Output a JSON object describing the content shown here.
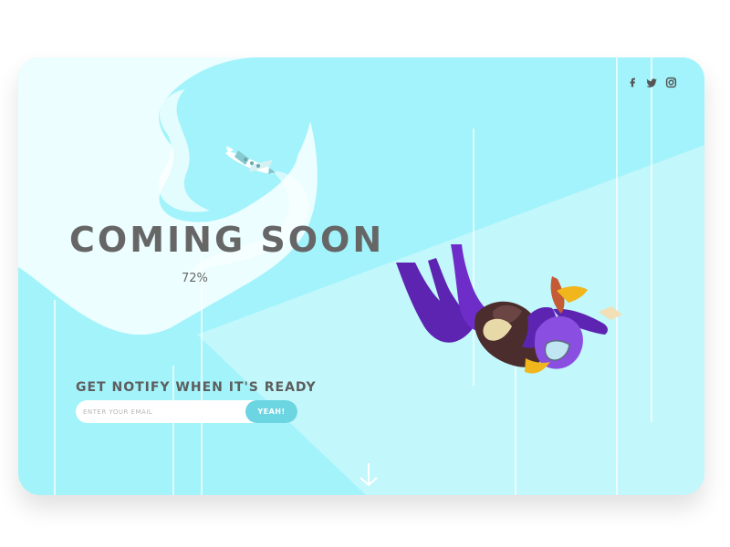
{
  "page": {
    "title": "COMING SOON",
    "progress_label": "72%",
    "progress_value": 0.72
  },
  "social": {
    "items": [
      {
        "name": "facebook",
        "icon": "facebook-icon"
      },
      {
        "name": "twitter",
        "icon": "twitter-icon"
      },
      {
        "name": "instagram",
        "icon": "instagram-icon"
      }
    ]
  },
  "notify": {
    "heading": "GET NOTIFY WHEN IT'S READY",
    "email_placeholder": "ENTER YOUR EMAIL",
    "email_value": "",
    "submit_label": "YEAH!"
  },
  "scroll": {
    "icon": "arrow-down-icon"
  },
  "colors": {
    "background": "#a3f3fb",
    "cloud": "#ecfeff",
    "text": "#666666",
    "button": "#6bd5e1",
    "suit": "#5c24b1",
    "parachute_pack": "#4b2d2d",
    "scarf": "#f1b61b",
    "hair": "#c45b35"
  }
}
